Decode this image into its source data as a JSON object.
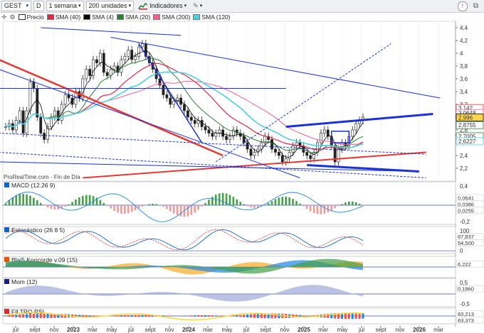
{
  "toolbar": {
    "symbol": "GEST",
    "mode": "D",
    "period": "1 semana",
    "units": "200 unidades",
    "indicators_label": "Indicadores"
  },
  "legend": [
    {
      "label": "Precio",
      "color": "#2b2b2b"
    },
    {
      "label": "SMA (40)",
      "color": "#e0284a"
    },
    {
      "label": "SMA (4)",
      "color": "#000000"
    },
    {
      "label": "SMA (20)",
      "color": "#2e7d32"
    },
    {
      "label": "SMA (200)",
      "color": "#f06292"
    },
    {
      "label": "SMA (120)",
      "color": "#4dd0e1"
    }
  ],
  "watermark": "ProRealTime.com - Fin de Día",
  "chart_data": [
    {
      "type": "line",
      "panel": "price",
      "y_ticks": [
        "4,4",
        "4,2",
        "4",
        "3,8",
        "3,6",
        "3,4",
        "3,2",
        "3",
        "2,8",
        "2,6",
        "2,4",
        "2,2"
      ],
      "ylim": [
        2.0,
        4.5
      ],
      "price_labels": [
        "3,142",
        "3,0648",
        "2,996",
        "2,8755",
        "2,7005",
        "2,6227"
      ],
      "x_ticks": [
        "jul",
        "sept",
        "nov",
        "2023",
        "mar",
        "may",
        "jul",
        "sept",
        "nov",
        "2024",
        "mar",
        "may",
        "jul",
        "sept",
        "nov",
        "2025",
        "mar",
        "may",
        "jul",
        "sept",
        "nov",
        "2026",
        "mar"
      ],
      "series": [
        {
          "name": "Precio",
          "values": [
            2.85,
            2.9,
            2.8,
            2.95,
            3.1,
            2.75,
            3.1,
            3.55,
            3.45,
            3.0,
            2.75,
            2.65,
            2.85,
            3.0,
            3.1,
            2.95,
            3.2,
            3.35,
            3.3,
            3.2,
            3.4,
            3.3,
            3.6,
            3.75,
            3.65,
            3.9,
            3.85,
            4.0,
            3.7,
            3.65,
            3.75,
            3.8,
            3.7,
            3.9,
            3.95,
            4.05,
            3.9,
            3.95,
            4.1,
            4.15,
            3.95,
            3.85,
            3.75,
            3.6,
            3.5,
            3.35,
            3.3,
            3.2,
            3.25,
            3.3,
            3.2,
            3.1,
            3.0,
            2.95,
            2.9,
            2.95,
            2.85,
            2.8,
            2.75,
            2.7,
            2.75,
            2.8,
            2.7,
            2.65,
            2.7,
            2.8,
            2.75,
            2.7,
            2.6,
            2.5,
            2.4,
            2.45,
            2.5,
            2.6,
            2.7,
            2.65,
            2.5,
            2.45,
            2.4,
            2.3,
            2.35,
            2.45,
            2.55,
            2.6,
            2.55,
            2.45,
            2.4,
            2.35,
            2.45,
            2.6,
            2.75,
            2.8,
            2.7,
            2.55,
            2.3,
            2.5,
            2.6,
            2.55,
            2.7,
            2.8,
            2.9,
            2.95,
            3.0
          ]
        }
      ]
    },
    {
      "type": "bar",
      "panel": "MACD (12.26 9)",
      "y_ticks": [
        "0,4",
        "0,2",
        "0",
        "-0,2"
      ],
      "value_labels": [
        "0,0641",
        "0,0386",
        "0,0255"
      ]
    },
    {
      "type": "line",
      "panel": "Estocástico (26 8 5)",
      "y_ticks": [
        "100",
        "0"
      ],
      "value_labels": [
        "67,837",
        "54,500"
      ]
    },
    {
      "type": "area",
      "panel": "Blai5 Koncorde v.09 (15)",
      "value_labels": [
        "6,222"
      ]
    },
    {
      "type": "area",
      "panel": "Mom (12)",
      "y_ticks": [
        "0,5",
        "-0,5"
      ],
      "value_labels": [
        "0,1860"
      ]
    },
    {
      "type": "bar",
      "panel": "FILTRO RSI",
      "value_labels": [
        "83,213",
        "63,373"
      ]
    }
  ]
}
